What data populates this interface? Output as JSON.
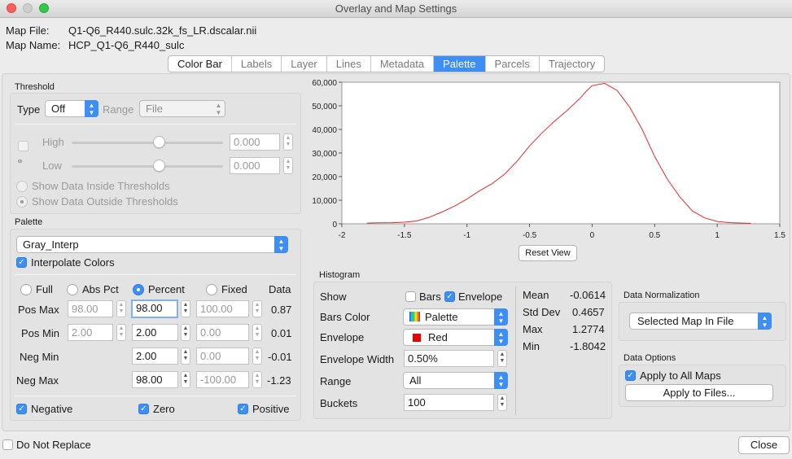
{
  "window": {
    "title": "Overlay and Map Settings"
  },
  "header": {
    "map_file_label": "Map File:",
    "map_file_value": "Q1-Q6_R440.sulc.32k_fs_LR.dscalar.nii",
    "map_name_label": "Map Name:",
    "map_name_value": "HCP_Q1-Q6_R440_sulc"
  },
  "tabs": [
    "Color Bar",
    "Labels",
    "Layer",
    "Lines",
    "Metadata",
    "Palette",
    "Parcels",
    "Trajectory"
  ],
  "active_tab": "Palette",
  "threshold": {
    "title": "Threshold",
    "type_label": "Type",
    "type_value": "Off",
    "range_label": "Range",
    "range_value": "File",
    "high_label": "High",
    "high_value": "0.000",
    "low_label": "Low",
    "low_value": "0.000",
    "show_inside": "Show Data Inside Thresholds",
    "show_outside": "Show Data Outside Thresholds"
  },
  "palette": {
    "title": "Palette",
    "name": "Gray_Interp",
    "interpolate_label": "Interpolate Colors",
    "modes": [
      "Full",
      "Abs Pct",
      "Percent",
      "Fixed"
    ],
    "data_header": "Data",
    "rows": [
      {
        "label": "Pos Max",
        "full": "98.00",
        "pct": "98.00",
        "fixed": "100.00",
        "data": "0.87"
      },
      {
        "label": "Pos Min",
        "full": "2.00",
        "pct": "2.00",
        "fixed": "0.00",
        "data": "0.01"
      },
      {
        "label": "Neg Min",
        "pct": "2.00",
        "fixed": "0.00",
        "data": "-0.01"
      },
      {
        "label": "Neg Max",
        "pct": "98.00",
        "fixed": "-100.00",
        "data": "-1.23"
      }
    ],
    "negative_label": "Negative",
    "zero_label": "Zero",
    "positive_label": "Positive"
  },
  "chart": {
    "reset_label": "Reset View",
    "line_color": "#e8282a"
  },
  "chart_data": {
    "type": "line",
    "title": "",
    "xlabel": "",
    "ylabel": "",
    "xlim": [
      -2,
      1.5
    ],
    "ylim": [
      0,
      60000
    ],
    "xticks": [
      "-2",
      "-1.5",
      "-1",
      "-0.5",
      "0",
      "0.5",
      "1",
      "1.5"
    ],
    "yticks": [
      "0",
      "10,000",
      "20,000",
      "30,000",
      "40,000",
      "50,000",
      "60,000"
    ],
    "series": [
      {
        "x": [
          -1.8,
          -1.7,
          -1.6,
          -1.5,
          -1.4,
          -1.3,
          -1.2,
          -1.1,
          -1.0,
          -0.9,
          -0.8,
          -0.7,
          -0.6,
          -0.5,
          -0.4,
          -0.3,
          -0.2,
          -0.1,
          -0.05,
          0.0,
          0.05,
          0.1,
          0.15,
          0.2,
          0.3,
          0.4,
          0.5,
          0.6,
          0.7,
          0.8,
          0.9,
          1.0,
          1.1,
          1.2,
          1.27
        ],
        "y": [
          300,
          400,
          500,
          700,
          1200,
          2800,
          5000,
          7500,
          10500,
          14000,
          17000,
          21000,
          26500,
          33000,
          38500,
          43500,
          48000,
          53000,
          56000,
          58500,
          59000,
          59500,
          58000,
          56500,
          49500,
          40000,
          28500,
          19000,
          11500,
          5500,
          2500,
          1000,
          500,
          300,
          200
        ]
      }
    ]
  },
  "histogram": {
    "title": "Histogram",
    "show_label": "Show",
    "bars_label": "Bars",
    "envelope_label": "Envelope",
    "bars_color_label": "Bars Color",
    "bars_color_value": "Palette",
    "envelope_row_label": "Envelope",
    "envelope_color_value": "Red",
    "envelope_width_label": "Envelope Width",
    "envelope_width_value": "0.50%",
    "range_label": "Range",
    "range_value": "All",
    "buckets_label": "Buckets",
    "buckets_value": "100",
    "stats": [
      {
        "label": "Mean",
        "value": "-0.0614"
      },
      {
        "label": "Std Dev",
        "value": "0.4657"
      },
      {
        "label": "Max",
        "value": "1.2774"
      },
      {
        "label": "Min",
        "value": "-1.8042"
      }
    ],
    "envelope_swatch": "#e60000"
  },
  "normalization": {
    "title": "Data Normalization",
    "value": "Selected Map In File"
  },
  "data_options": {
    "title": "Data Options",
    "apply_all_label": "Apply to All Maps",
    "apply_files_label": "Apply to Files..."
  },
  "footer": {
    "do_not_replace_label": "Do Not Replace",
    "close_label": "Close"
  },
  "colors": {
    "accent": "#3d8ff5"
  }
}
